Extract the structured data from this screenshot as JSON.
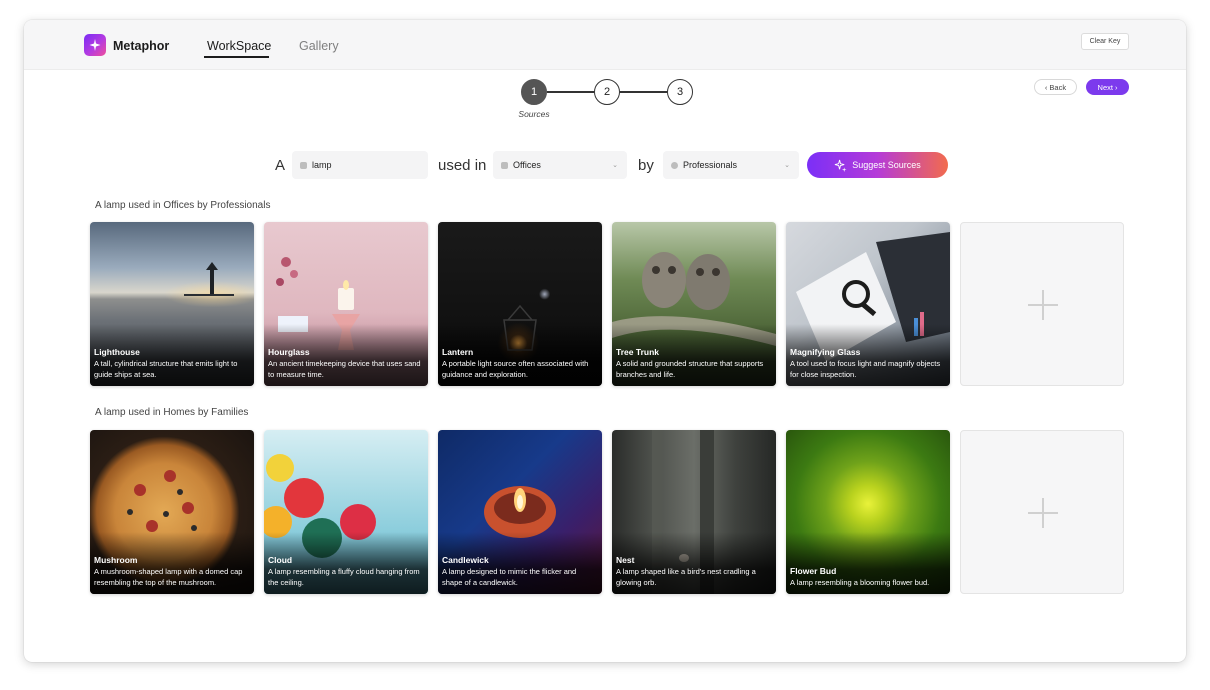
{
  "app": {
    "brand": "Metaphor",
    "tabs": [
      {
        "label": "WorkSpace",
        "active": true
      },
      {
        "label": "Gallery",
        "active": false
      }
    ],
    "clear_key_label": "Clear Key"
  },
  "stepper": {
    "steps": [
      "1",
      "2",
      "3"
    ],
    "active_index": 0,
    "active_label": "Sources",
    "back_label": "Back",
    "next_label": "Next"
  },
  "query": {
    "prefix": "A",
    "object_value": "lamp",
    "connector_1": "used in",
    "place_value": "Offices",
    "connector_2": "by",
    "user_value": "Professionals",
    "suggest_label": "Suggest Sources"
  },
  "sections": [
    {
      "title": "A lamp used in Offices by Professionals",
      "cards": [
        {
          "title": "Lighthouse",
          "description": "A tall, cylindrical structure that emits light to guide ships at sea."
        },
        {
          "title": "Hourglass",
          "description": "An ancient timekeeping device that uses sand to measure time."
        },
        {
          "title": "Lantern",
          "description": "A portable light source often associated with guidance and exploration."
        },
        {
          "title": "Tree Trunk",
          "description": "A solid and grounded structure that supports branches and life."
        },
        {
          "title": "Magnifying Glass",
          "description": "A tool used to focus light and magnify objects for close inspection."
        }
      ]
    },
    {
      "title": "A lamp used in Homes by Families",
      "cards": [
        {
          "title": "Mushroom",
          "description": "A mushroom-shaped lamp with a domed cap resembling the top of the mushroom."
        },
        {
          "title": "Cloud",
          "description": "A lamp resembling a fluffy cloud hanging from the ceiling."
        },
        {
          "title": "Candlewick",
          "description": "A lamp designed to mimic the flicker and shape of a candlewick."
        },
        {
          "title": "Nest",
          "description": "A lamp shaped like a bird's nest cradling a glowing orb."
        },
        {
          "title": "Flower Bud",
          "description": "A lamp resembling a blooming flower bud."
        }
      ]
    }
  ],
  "colors": {
    "accent": "#7c3aed",
    "suggest_gradient_start": "#7b2ff7",
    "suggest_gradient_end": "#f26b4d"
  }
}
